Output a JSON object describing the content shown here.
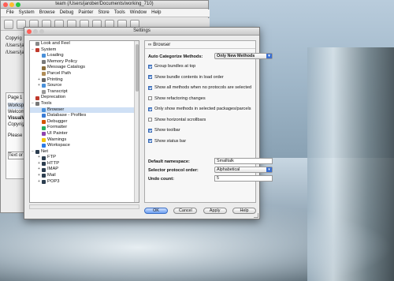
{
  "colors": {
    "accent": "#5c8fd6",
    "selection": "#cfe0f5"
  },
  "main_window": {
    "title": "team (/Users/jarober/Documents/working_710)",
    "menu": [
      "File",
      "System",
      "Browse",
      "Debug",
      "Painter",
      "Store",
      "Tools",
      "Window",
      "Help"
    ],
    "side_lines": [
      "Copyrig",
      "/Users/ja",
      "/Users/ja"
    ],
    "side2_tabs": [
      "Page",
      "1"
    ],
    "side2_lines": [
      "Workspace",
      "Welcom",
      "VisualWo",
      "Copyrig",
      "Please",
      "Text or"
    ]
  },
  "dialog": {
    "title": "Settings",
    "tree": [
      {
        "label": "Look and Feel",
        "level": 0,
        "icon": "settings-icon",
        "expander": ""
      },
      {
        "label": "System",
        "level": 0,
        "icon": "system-icon",
        "expander": "−"
      },
      {
        "label": "Loading",
        "level": 1,
        "icon": "loading-icon",
        "expander": ""
      },
      {
        "label": "Memory Policy",
        "level": 1,
        "icon": "memory-icon",
        "expander": ""
      },
      {
        "label": "Message Catalogs",
        "level": 1,
        "icon": "catalog-icon",
        "expander": ""
      },
      {
        "label": "Parcel Path",
        "level": 1,
        "icon": "parcel-icon",
        "expander": ""
      },
      {
        "label": "Printing",
        "level": 1,
        "icon": "printer-icon",
        "expander": "+"
      },
      {
        "label": "Source",
        "level": 1,
        "icon": "source-icon",
        "expander": "+"
      },
      {
        "label": "Transcript",
        "level": 1,
        "icon": "transcript-icon",
        "expander": ""
      },
      {
        "label": "Deprecation",
        "level": 0,
        "icon": "deprecation-icon",
        "expander": ""
      },
      {
        "label": "Tools",
        "level": 0,
        "icon": "tools-icon",
        "expander": "−"
      },
      {
        "label": "Browser",
        "level": 1,
        "icon": "browser-icon",
        "expander": "",
        "selected": true
      },
      {
        "label": "Database - Profiles",
        "level": 1,
        "icon": "database-icon",
        "expander": ""
      },
      {
        "label": "Debugger",
        "level": 1,
        "icon": "debugger-icon",
        "expander": ""
      },
      {
        "label": "Formatter",
        "level": 1,
        "icon": "formatter-icon",
        "expander": ""
      },
      {
        "label": "UI Painter",
        "level": 1,
        "icon": "painter-icon",
        "expander": ""
      },
      {
        "label": "Warnings",
        "level": 1,
        "icon": "warning-icon",
        "expander": ""
      },
      {
        "label": "Workspace",
        "level": 1,
        "icon": "workspace-icon",
        "expander": ""
      },
      {
        "label": "Net",
        "level": 0,
        "icon": "net-icon",
        "expander": "−"
      },
      {
        "label": "FTP",
        "level": 1,
        "icon": "ftp-icon",
        "expander": "+"
      },
      {
        "label": "HTTP",
        "level": 1,
        "icon": "http-icon",
        "expander": "+"
      },
      {
        "label": "IMAP",
        "level": 1,
        "icon": "imap-icon",
        "expander": "+"
      },
      {
        "label": "Mail",
        "level": 1,
        "icon": "mail-icon",
        "expander": "+"
      },
      {
        "label": "POP3",
        "level": 1,
        "icon": "pop3-icon",
        "expander": "+"
      }
    ],
    "panel": {
      "header": "Browser",
      "auto_cat_label": "Auto Categorize Methods:",
      "auto_cat_value": "Only New Methods",
      "checkboxes": [
        {
          "label": "Group bundles at top",
          "checked": true
        },
        {
          "label": "Show bundle contents in load order",
          "checked": true
        },
        {
          "label": "Show all methods when no protocols are selected",
          "checked": true
        },
        {
          "label": "Show refactoring changes",
          "checked": false
        },
        {
          "label": "Only show methods in selected packages/parcels",
          "checked": true
        },
        {
          "label": "Show horizontal scrollbars",
          "checked": false
        },
        {
          "label": "Show toolbar",
          "checked": true
        },
        {
          "label": "Show status bar",
          "checked": true
        }
      ],
      "default_namespace_label": "Default namespace:",
      "default_namespace_value": "Smalltalk",
      "selector_order_label": "Selector protocol order:",
      "selector_order_value": "Alphabetical",
      "undo_label": "Undo count:",
      "undo_value": "5"
    },
    "buttons": {
      "ok": "OK",
      "cancel": "Cancel",
      "apply": "Apply",
      "help": "Help"
    }
  }
}
